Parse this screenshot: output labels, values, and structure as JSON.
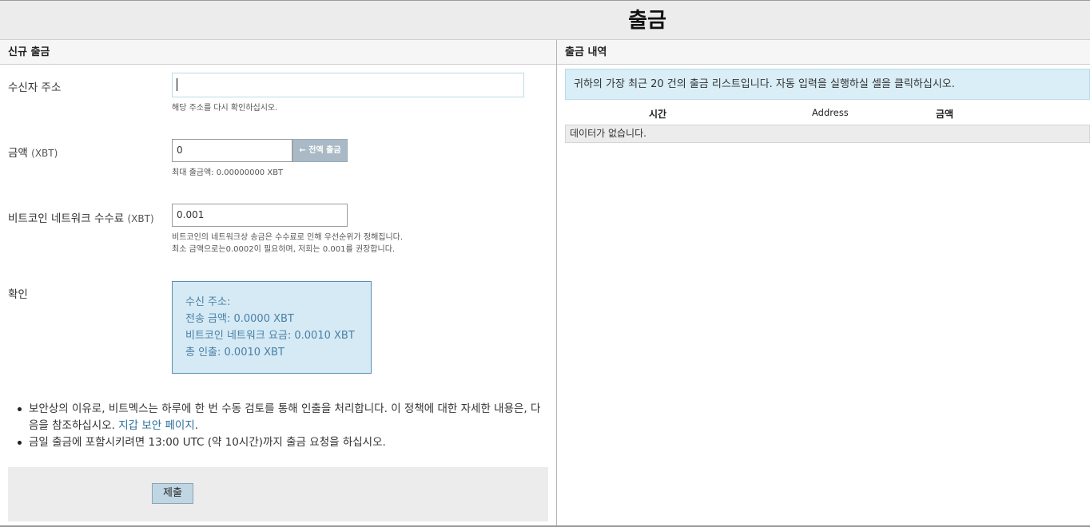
{
  "page_title": "출금",
  "new_withdrawal": {
    "header": "신규 출금",
    "address": {
      "label": "수신자 주소",
      "value": "",
      "help": "해당 주소를 다시 확인하십시오."
    },
    "amount": {
      "label": "금액",
      "unit": "(XBT)",
      "value": "0",
      "withdraw_all_label": "전액 출금",
      "help": "최대 출금액: 0.00000000 XBT"
    },
    "fee": {
      "label": "비트코인 네트워크 수수료",
      "unit": "(XBT)",
      "value": "0.001",
      "help_line1": "비트코인의 네트워크상 송금은 수수료로 인해 우선순위가 정해집니다.",
      "help_line2": "최소 금액으로는0.0002이 필요하며, 저희는 0.001를 권장합니다."
    },
    "confirm": {
      "label": "확인",
      "recipient": "수신 주소:",
      "send_amount": "전송 금액: 0.0000 XBT",
      "network_fee": "비트코인 네트워크 요금: 0.0010 XBT",
      "total": "총 인출: 0.0010 XBT"
    },
    "notes": {
      "note1_text": "보안상의 이유로, 비트멕스는 하루에 한 번 수동 검토를 통해 인출을 처리합니다. 이 정책에 대한 자세한 내용은, 다음을 참조하십시오. ",
      "note1_link": "지갑 보안 페이지",
      "note1_end": ".",
      "note2": "금일 출금에 포함시키려면 13:00 UTC (약 10시간)까지 출금 요청을 하십시오."
    },
    "submit_label": "제출"
  },
  "history": {
    "header": "출금 내역",
    "info": "귀하의 가장 최근 20 건의 출금 리스트입니다. 자동 입력을 실행하실 셀을 클릭하십시오.",
    "columns": [
      "시간",
      "Address",
      "금액"
    ],
    "empty_message": "데이터가 없습니다."
  }
}
